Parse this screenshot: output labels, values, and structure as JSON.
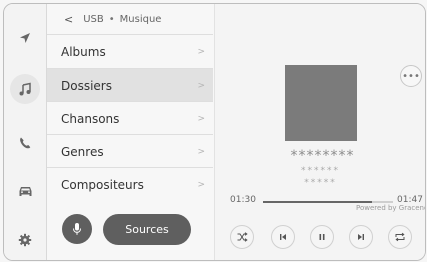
{
  "breadcrumb": {
    "back_glyph": "<",
    "source": "USB",
    "separator": "•",
    "section": "Musique"
  },
  "browser_list": [
    {
      "label": "Albums",
      "selected": false
    },
    {
      "label": "Dossiers",
      "selected": true
    },
    {
      "label": "Chansons",
      "selected": false
    },
    {
      "label": "Genres",
      "selected": false
    },
    {
      "label": "Compositeurs",
      "selected": false
    }
  ],
  "chevron_glyph": ">",
  "sources_label": "Sources",
  "player": {
    "more_glyph": "•••",
    "title_mask": "********",
    "artist_mask": "******",
    "album_mask": "*****",
    "elapsed": "01:30",
    "duration": "01:47",
    "progress_fraction": 0.84,
    "gracenote_text": "Powered by Gracenote®"
  },
  "rail_icons": [
    "navigation-icon",
    "music-icon",
    "phone-icon",
    "car-icon",
    "settings-icon"
  ],
  "colors": {
    "accent_dark": "#5f5f5f",
    "selected_row": "#e1e1e1",
    "artwork": "#7b7b7b"
  }
}
